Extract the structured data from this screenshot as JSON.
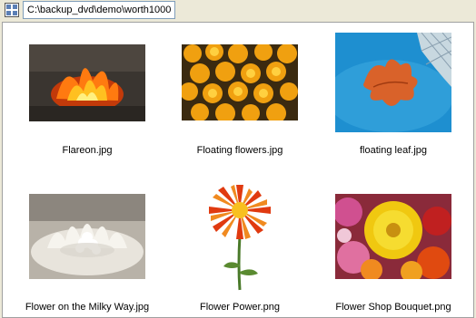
{
  "window": {
    "path": "C:\\backup_dvd\\demo\\worth1000"
  },
  "icons": {
    "path_icon": "thumbnails-view-icon"
  },
  "items": [
    {
      "label": "Flareon.jpg",
      "image": "fire-fox-image"
    },
    {
      "label": "Floating flowers.jpg",
      "image": "marigold-flowers-image"
    },
    {
      "label": "floating leaf.jpg",
      "image": "autumn-leaf-on-water-image"
    },
    {
      "label": "Flower on the Milky Way.jpg",
      "image": "milk-splash-flower-image"
    },
    {
      "label": "Flower Power.png",
      "image": "red-orange-flower-image"
    },
    {
      "label": "Flower Shop Bouquet.png",
      "image": "zinnia-bouquet-image"
    }
  ],
  "colors": {
    "window_bg": "#ece9d8",
    "content_bg": "#ffffff",
    "pathbox_border": "#7f9db9"
  }
}
